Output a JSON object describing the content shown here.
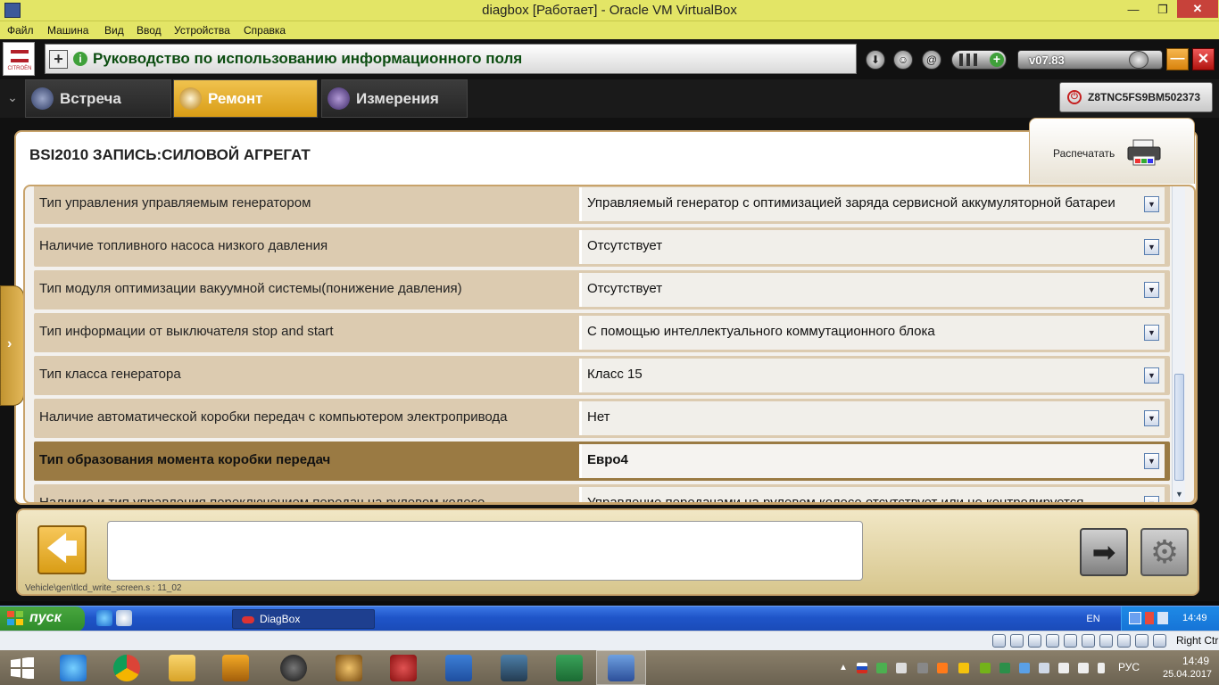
{
  "window": {
    "title": "diagbox [Работает] - Oracle VM VirtualBox",
    "min_glyph": "—",
    "max_glyph": "❐",
    "close_glyph": "✕"
  },
  "vb_menu": [
    "Файл",
    "Машина",
    "Вид",
    "Ввод",
    "Устройства",
    "Справка"
  ],
  "diagbox": {
    "logo_text": "CITROËN",
    "help_plus": "+",
    "help_info": "i",
    "help_text": "Руководство по использованию информационного поля",
    "version": "v07.83",
    "header_icons": [
      "download-icon",
      "contact-icon",
      "email-icon"
    ],
    "min_label": "—",
    "close_label": "✕"
  },
  "tabs": [
    {
      "label": "Встреча",
      "icon": "meeting-icon",
      "active": false
    },
    {
      "label": "Ремонт",
      "icon": "magnifier-icon",
      "active": true
    },
    {
      "label": "Измерения",
      "icon": "waveform-icon",
      "active": false
    }
  ],
  "vin": "Z8TNC5FS9BM502373",
  "page": {
    "title": "BSI2010  ЗАПИСЬ:СИЛОВОЙ АГРЕГАТ",
    "print_label": "Распечатать"
  },
  "rows": [
    {
      "label": "Тип управления управляемым генератором",
      "value": "Управляемый генератор с оптимизацией заряда сервисной аккумуляторной батареи",
      "selected": false
    },
    {
      "label": "Наличие топливного насоса низкого давления",
      "value": "Отсутствует",
      "selected": false
    },
    {
      "label": "Тип модуля оптимизации вакуумной системы(понижение давления)",
      "value": "Отсутствует",
      "selected": false
    },
    {
      "label": "Тип информации от выключателя stop and start",
      "value": "С помощью интеллектуального коммутационного блока",
      "selected": false
    },
    {
      "label": "Тип класса генератора",
      "value": "Класс 15",
      "selected": false
    },
    {
      "label": "Наличие автоматической коробки передач с компьютером электропривода",
      "value": "Нет",
      "selected": false
    },
    {
      "label": "Тип образования момента коробки передач",
      "value": "Евро4",
      "selected": true
    },
    {
      "label": "Наличие и тип управления переключением передач на рулевом колесе",
      "value": "Управление передачами на рулевом колесе отсутствует или не контролируется",
      "selected": false
    }
  ],
  "bottom": {
    "script_path": "Vehicle\\gen\\tlcd_write_screen.s : 11_02",
    "back_glyph": "🡄",
    "forward_glyph": "➡",
    "gear_glyph": "⚙"
  },
  "vm_taskbar": {
    "start_label": "пуск",
    "task_label": "DiagBox",
    "lang": "EN",
    "clock": "14:49"
  },
  "vb_status": {
    "host_key": "Right Ctrl"
  },
  "host_taskbar": {
    "lang": "РУС",
    "time": "14:49",
    "date": "25.04.2017",
    "apps": [
      "internet-explorer-icon",
      "chrome-icon",
      "file-explorer-icon",
      "media-app-icon",
      "speaker-app-icon",
      "diagnostic-app-icon",
      "power-app-icon",
      "word-icon",
      "calculator-app-icon",
      "excel-icon",
      "virtualbox-icon"
    ]
  },
  "colors": {
    "title_bar": "#e3e566",
    "accent_gold": "#d99d16",
    "row_bg": "#dccbb0",
    "row_selected": "#9a7a43",
    "help_text": "#0c4d11",
    "xp_blue": "#1f55c9"
  }
}
